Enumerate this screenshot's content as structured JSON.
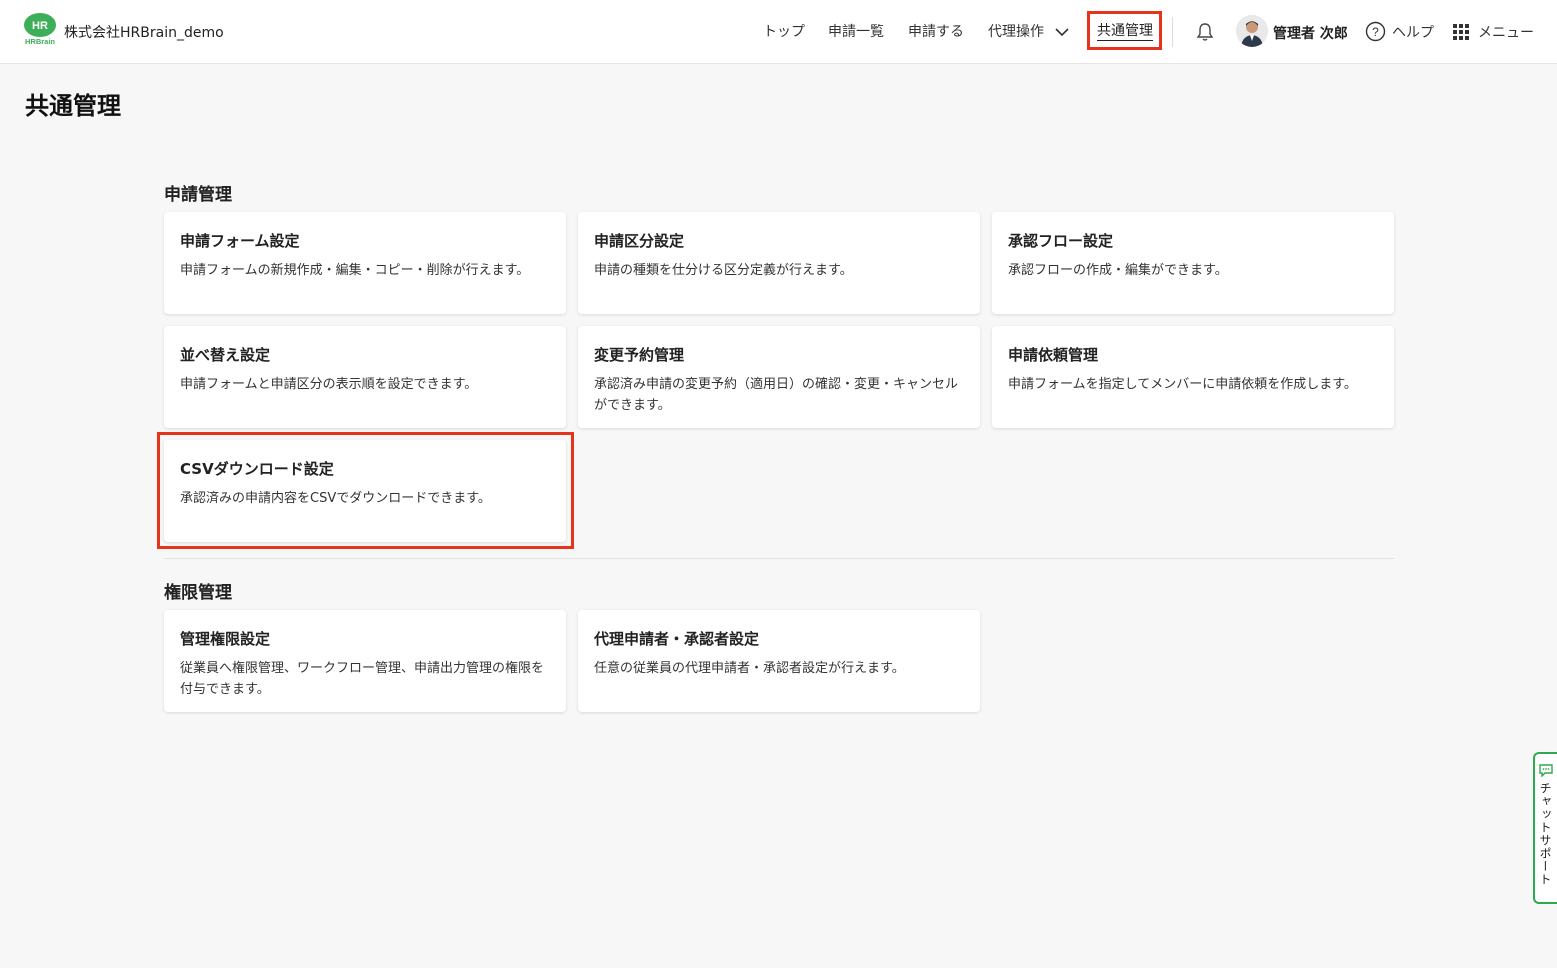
{
  "header": {
    "logo_text": "HR",
    "logo_subtext": "HRBrain",
    "company": "株式会社HRBrain_demo",
    "nav": {
      "top": "トップ",
      "list": "申請一覧",
      "apply": "申請する",
      "proxy": "代理操作",
      "common": "共通管理"
    },
    "user_name": "管理者 次郎",
    "help": "ヘルプ",
    "menu": "メニュー"
  },
  "page": {
    "title": "共通管理"
  },
  "sections": {
    "application": {
      "title": "申請管理",
      "cards": [
        {
          "title": "申請フォーム設定",
          "desc": "申請フォームの新規作成・編集・コピー・削除が行えます。"
        },
        {
          "title": "申請区分設定",
          "desc": "申請の種類を仕分ける区分定義が行えます。"
        },
        {
          "title": "承認フロー設定",
          "desc": "承認フローの作成・編集ができます。"
        },
        {
          "title": "並べ替え設定",
          "desc": "申請フォームと申請区分の表示順を設定できます。"
        },
        {
          "title": "変更予約管理",
          "desc": "承認済み申請の変更予約（適用日）の確認・変更・キャンセルができます。"
        },
        {
          "title": "申請依頼管理",
          "desc": "申請フォームを指定してメンバーに申請依頼を作成します。"
        },
        {
          "title": "CSVダウンロード設定",
          "desc": "承認済みの申請内容をCSVでダウンロードできます。"
        }
      ]
    },
    "permission": {
      "title": "権限管理",
      "cards": [
        {
          "title": "管理権限設定",
          "desc": "従業員へ権限管理、ワークフロー管理、申請出力管理の権限を付与できます。"
        },
        {
          "title": "代理申請者・承認者設定",
          "desc": "任意の従業員の代理申請者・承認者設定が行えます。"
        }
      ]
    }
  },
  "chat_support": "チャットサポート",
  "colors": {
    "highlight": "#e8331c",
    "brand_green": "#2fa84f"
  }
}
